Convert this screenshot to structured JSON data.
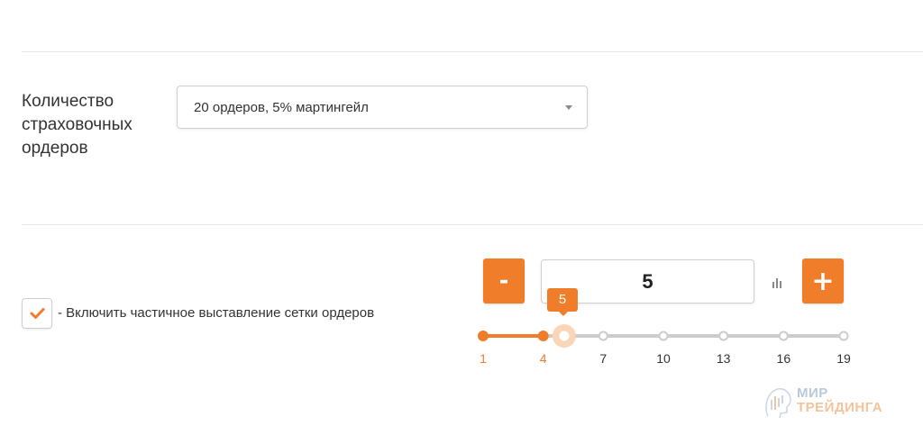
{
  "orders_setting": {
    "label": "Количество страховочных ордеров",
    "selected": "20 ордеров, 5% мартингейл"
  },
  "partial_grid": {
    "checked": true,
    "label": "- Включить частичное выставление сетки ордеров"
  },
  "stepper": {
    "minus_label": "-",
    "plus_label": "+",
    "value": "5"
  },
  "slider": {
    "min": 1,
    "max": 19,
    "value": 5,
    "tooltip": "5",
    "ticks": [
      "1",
      "4",
      "7",
      "10",
      "13",
      "16",
      "19"
    ],
    "accent_color": "#f07d2a",
    "track_color": "#cccccc"
  },
  "watermark": {
    "line1": "МИР",
    "line2": "ТРЕЙДИНГА"
  }
}
